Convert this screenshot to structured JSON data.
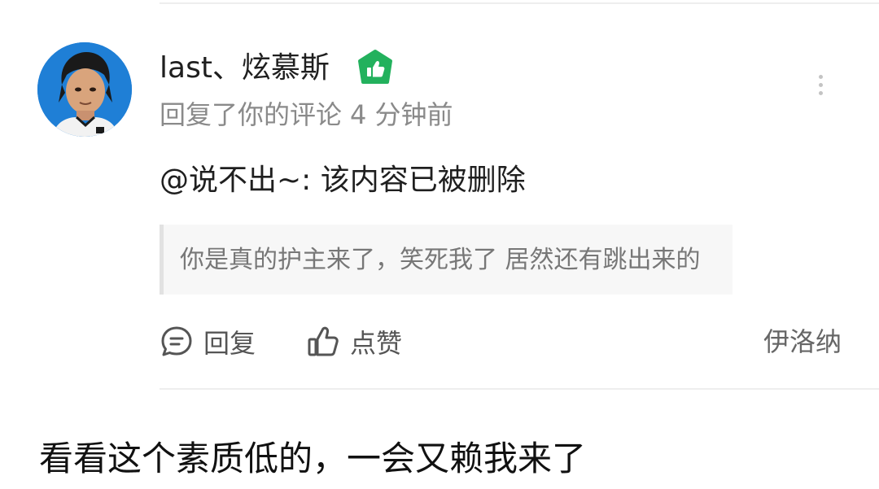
{
  "comment": {
    "username": "last、炫慕斯",
    "verified_icon": "thumbs-up-badge-icon",
    "action_text": "回复了你的评论",
    "time_ago": "4 分钟前",
    "reply_text": "@说不出~: 该内容已被删除",
    "quoted_text": "你是真的护主来了，笑死我了 居然还有跳出来的",
    "actions": {
      "reply_label": "回复",
      "like_label": "点赞"
    },
    "location": "伊洛纳"
  },
  "caption": "看看这个素质低的，一会又赖我来了",
  "colors": {
    "badge_green": "#23b15d",
    "avatar_bg": "#1f7fd6",
    "meta_gray": "#8a8a8a"
  }
}
